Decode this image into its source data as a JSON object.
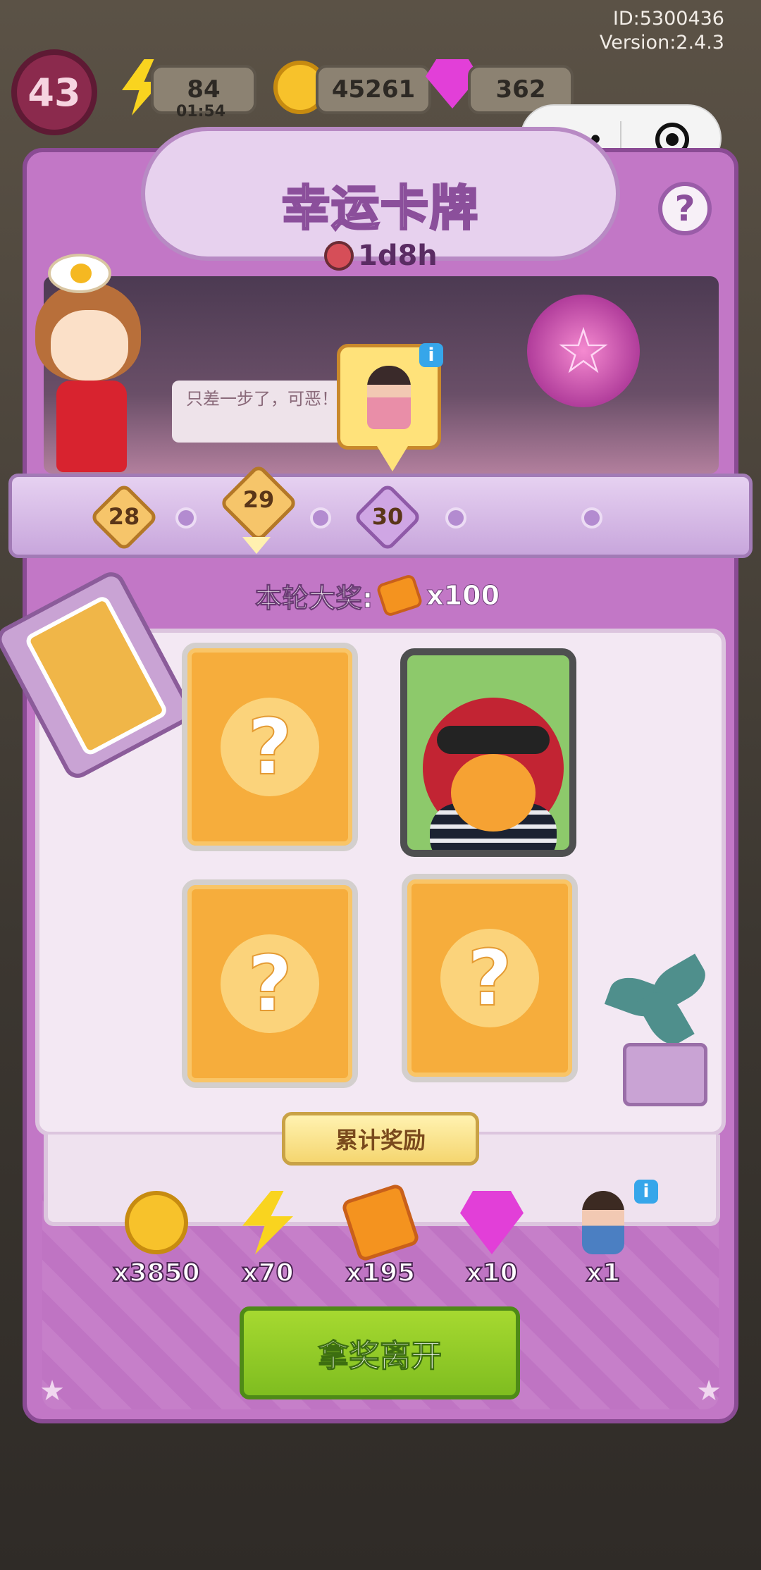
{
  "meta": {
    "id": "ID:5300436",
    "version": "Version:2.4.3"
  },
  "hud": {
    "level": "43",
    "energy": "84",
    "energy_timer": "01:54",
    "coins": "45261",
    "gems": "362"
  },
  "panel": {
    "title": "幸运卡牌",
    "countdown": "1d8h",
    "help": "?",
    "speech": "只差一步了，可恶！",
    "milestones": [
      "28",
      "29",
      "30"
    ],
    "grand_prize_label": "本轮大奖:",
    "grand_prize_amount": "x100",
    "card_question": "?",
    "accum_label": "累计奖励",
    "rewards": [
      {
        "icon": "coin-icon",
        "amount": "x3850"
      },
      {
        "icon": "energy-bolt-icon",
        "amount": "x70"
      },
      {
        "icon": "ticket-icon",
        "amount": "x195"
      },
      {
        "icon": "gem-icon",
        "amount": "x10"
      },
      {
        "icon": "character-icon",
        "amount": "x1"
      }
    ],
    "leave_button": "拿奖离开"
  },
  "colors": {
    "panel": "#c277c6",
    "card_back": "#f6ad3c",
    "leave_button": "#8fcb26"
  }
}
